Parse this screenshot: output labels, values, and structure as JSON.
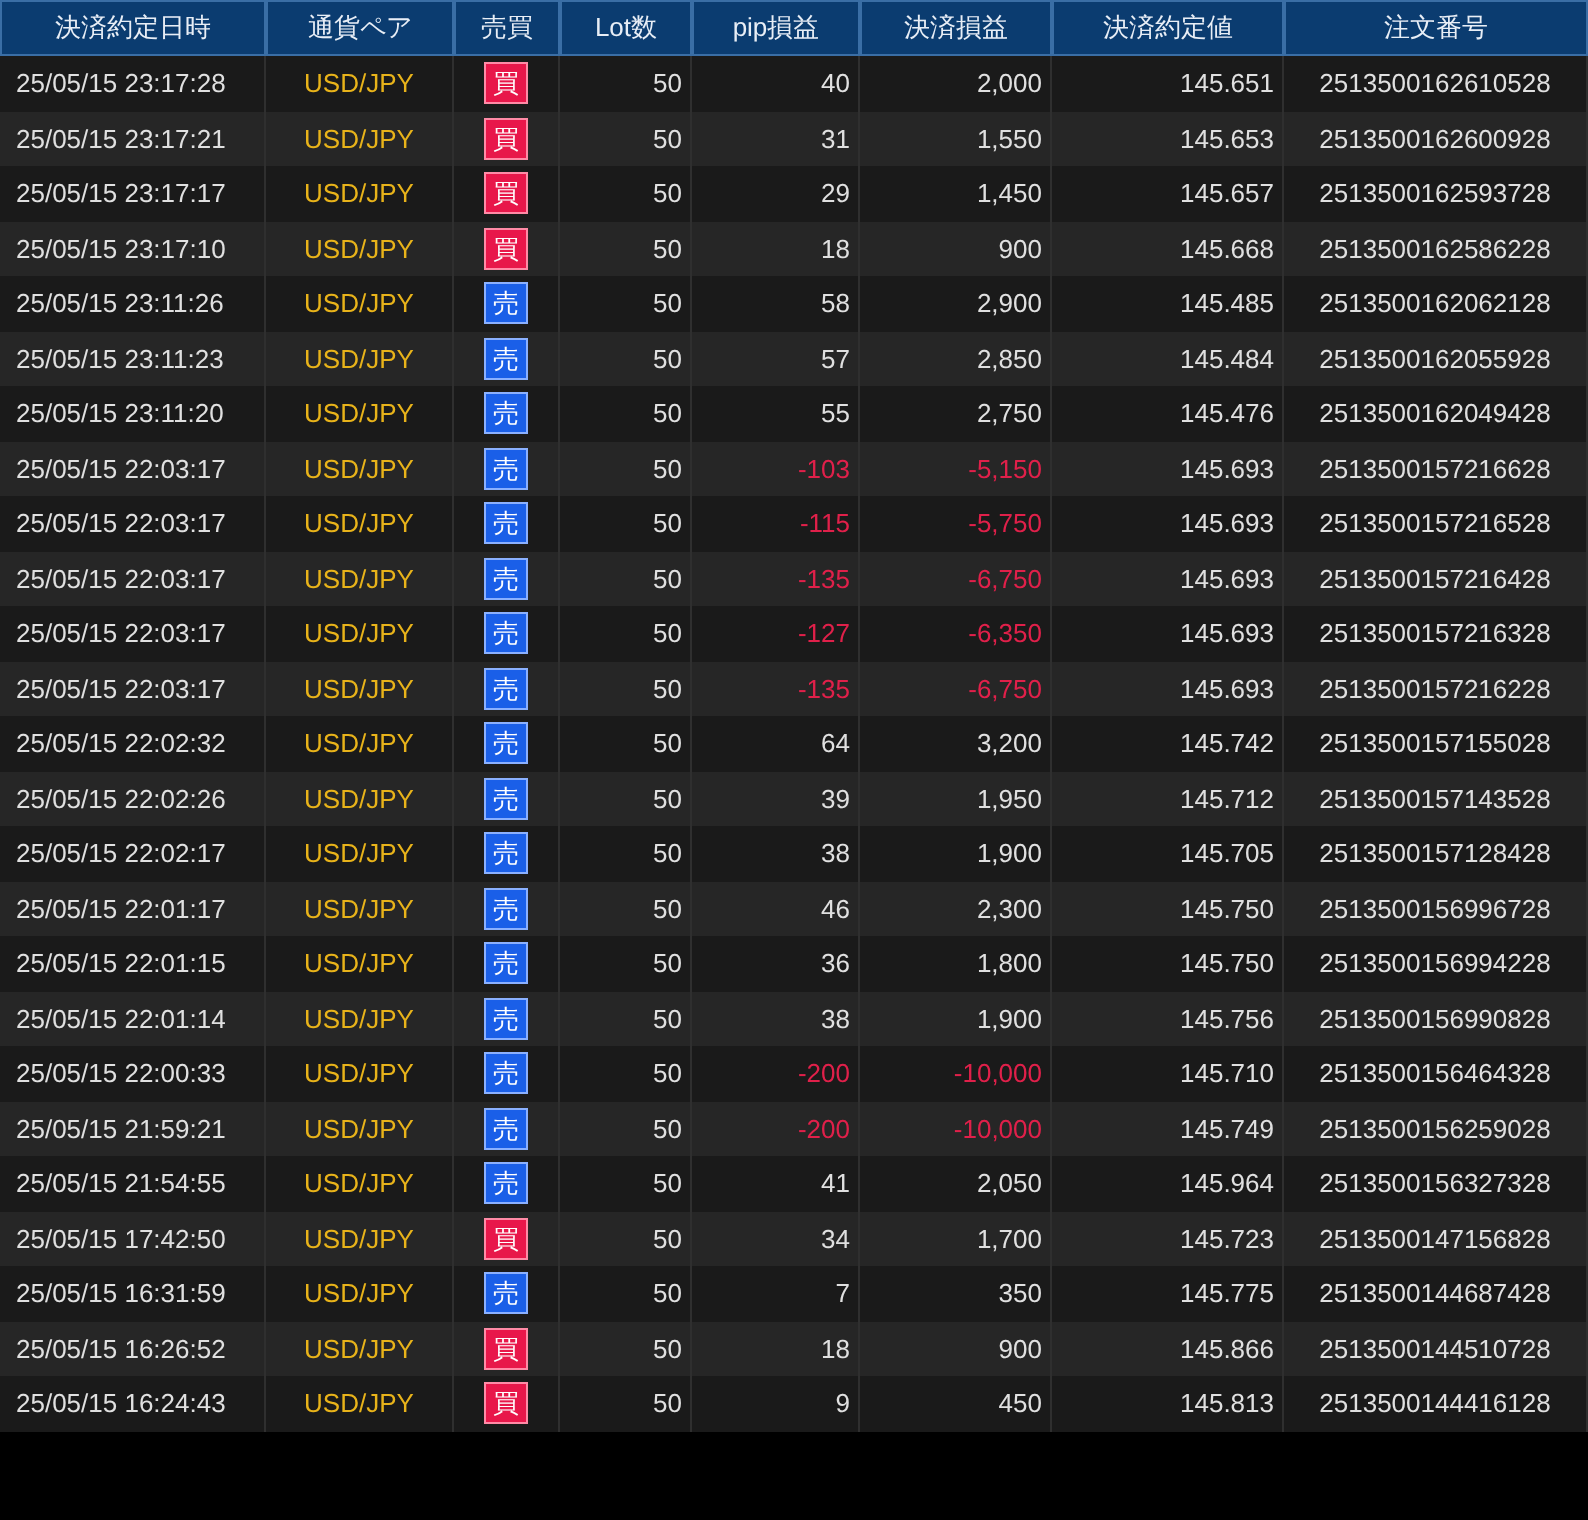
{
  "table": {
    "columns": [
      "決済約定日時",
      "通貨ペア",
      "売買",
      "Lot数",
      "pip損益",
      "決済損益",
      "決済約定値",
      "注文番号"
    ],
    "rows": [
      {
        "time": "25/05/15 23:17:28",
        "pair": "USD/JPY",
        "side": "買",
        "kind": "buy",
        "lots": "50",
        "pips": "40",
        "pl": "2,000",
        "price": "145.651",
        "order": "2513500162610528",
        "loss": false
      },
      {
        "time": "25/05/15 23:17:21",
        "pair": "USD/JPY",
        "side": "買",
        "kind": "buy",
        "lots": "50",
        "pips": "31",
        "pl": "1,550",
        "price": "145.653",
        "order": "2513500162600928",
        "loss": false
      },
      {
        "time": "25/05/15 23:17:17",
        "pair": "USD/JPY",
        "side": "買",
        "kind": "buy",
        "lots": "50",
        "pips": "29",
        "pl": "1,450",
        "price": "145.657",
        "order": "2513500162593728",
        "loss": false
      },
      {
        "time": "25/05/15 23:17:10",
        "pair": "USD/JPY",
        "side": "買",
        "kind": "buy",
        "lots": "50",
        "pips": "18",
        "pl": "900",
        "price": "145.668",
        "order": "2513500162586228",
        "loss": false
      },
      {
        "time": "25/05/15 23:11:26",
        "pair": "USD/JPY",
        "side": "売",
        "kind": "sell",
        "lots": "50",
        "pips": "58",
        "pl": "2,900",
        "price": "145.485",
        "order": "2513500162062128",
        "loss": false
      },
      {
        "time": "25/05/15 23:11:23",
        "pair": "USD/JPY",
        "side": "売",
        "kind": "sell",
        "lots": "50",
        "pips": "57",
        "pl": "2,850",
        "price": "145.484",
        "order": "2513500162055928",
        "loss": false
      },
      {
        "time": "25/05/15 23:11:20",
        "pair": "USD/JPY",
        "side": "売",
        "kind": "sell",
        "lots": "50",
        "pips": "55",
        "pl": "2,750",
        "price": "145.476",
        "order": "2513500162049428",
        "loss": false
      },
      {
        "time": "25/05/15 22:03:17",
        "pair": "USD/JPY",
        "side": "売",
        "kind": "sell",
        "lots": "50",
        "pips": "-103",
        "pl": "-5,150",
        "price": "145.693",
        "order": "2513500157216628",
        "loss": true
      },
      {
        "time": "25/05/15 22:03:17",
        "pair": "USD/JPY",
        "side": "売",
        "kind": "sell",
        "lots": "50",
        "pips": "-115",
        "pl": "-5,750",
        "price": "145.693",
        "order": "2513500157216528",
        "loss": true
      },
      {
        "time": "25/05/15 22:03:17",
        "pair": "USD/JPY",
        "side": "売",
        "kind": "sell",
        "lots": "50",
        "pips": "-135",
        "pl": "-6,750",
        "price": "145.693",
        "order": "2513500157216428",
        "loss": true
      },
      {
        "time": "25/05/15 22:03:17",
        "pair": "USD/JPY",
        "side": "売",
        "kind": "sell",
        "lots": "50",
        "pips": "-127",
        "pl": "-6,350",
        "price": "145.693",
        "order": "2513500157216328",
        "loss": true
      },
      {
        "time": "25/05/15 22:03:17",
        "pair": "USD/JPY",
        "side": "売",
        "kind": "sell",
        "lots": "50",
        "pips": "-135",
        "pl": "-6,750",
        "price": "145.693",
        "order": "2513500157216228",
        "loss": true
      },
      {
        "time": "25/05/15 22:02:32",
        "pair": "USD/JPY",
        "side": "売",
        "kind": "sell",
        "lots": "50",
        "pips": "64",
        "pl": "3,200",
        "price": "145.742",
        "order": "2513500157155028",
        "loss": false
      },
      {
        "time": "25/05/15 22:02:26",
        "pair": "USD/JPY",
        "side": "売",
        "kind": "sell",
        "lots": "50",
        "pips": "39",
        "pl": "1,950",
        "price": "145.712",
        "order": "2513500157143528",
        "loss": false
      },
      {
        "time": "25/05/15 22:02:17",
        "pair": "USD/JPY",
        "side": "売",
        "kind": "sell",
        "lots": "50",
        "pips": "38",
        "pl": "1,900",
        "price": "145.705",
        "order": "2513500157128428",
        "loss": false
      },
      {
        "time": "25/05/15 22:01:17",
        "pair": "USD/JPY",
        "side": "売",
        "kind": "sell",
        "lots": "50",
        "pips": "46",
        "pl": "2,300",
        "price": "145.750",
        "order": "2513500156996728",
        "loss": false
      },
      {
        "time": "25/05/15 22:01:15",
        "pair": "USD/JPY",
        "side": "売",
        "kind": "sell",
        "lots": "50",
        "pips": "36",
        "pl": "1,800",
        "price": "145.750",
        "order": "2513500156994228",
        "loss": false
      },
      {
        "time": "25/05/15 22:01:14",
        "pair": "USD/JPY",
        "side": "売",
        "kind": "sell",
        "lots": "50",
        "pips": "38",
        "pl": "1,900",
        "price": "145.756",
        "order": "2513500156990828",
        "loss": false
      },
      {
        "time": "25/05/15 22:00:33",
        "pair": "USD/JPY",
        "side": "売",
        "kind": "sell",
        "lots": "50",
        "pips": "-200",
        "pl": "-10,000",
        "price": "145.710",
        "order": "2513500156464328",
        "loss": true
      },
      {
        "time": "25/05/15 21:59:21",
        "pair": "USD/JPY",
        "side": "売",
        "kind": "sell",
        "lots": "50",
        "pips": "-200",
        "pl": "-10,000",
        "price": "145.749",
        "order": "2513500156259028",
        "loss": true
      },
      {
        "time": "25/05/15 21:54:55",
        "pair": "USD/JPY",
        "side": "売",
        "kind": "sell",
        "lots": "50",
        "pips": "41",
        "pl": "2,050",
        "price": "145.964",
        "order": "2513500156327328",
        "loss": false
      },
      {
        "time": "25/05/15 17:42:50",
        "pair": "USD/JPY",
        "side": "買",
        "kind": "buy",
        "lots": "50",
        "pips": "34",
        "pl": "1,700",
        "price": "145.723",
        "order": "2513500147156828",
        "loss": false
      },
      {
        "time": "25/05/15 16:31:59",
        "pair": "USD/JPY",
        "side": "売",
        "kind": "sell",
        "lots": "50",
        "pips": "7",
        "pl": "350",
        "price": "145.775",
        "order": "2513500144687428",
        "loss": false
      },
      {
        "time": "25/05/15 16:26:52",
        "pair": "USD/JPY",
        "side": "買",
        "kind": "buy",
        "lots": "50",
        "pips": "18",
        "pl": "900",
        "price": "145.866",
        "order": "2513500144510728",
        "loss": false
      },
      {
        "time": "25/05/15 16:24:43",
        "pair": "USD/JPY",
        "side": "買",
        "kind": "buy",
        "lots": "50",
        "pips": "9",
        "pl": "450",
        "price": "145.813",
        "order": "2513500144416128",
        "loss": false
      }
    ]
  }
}
